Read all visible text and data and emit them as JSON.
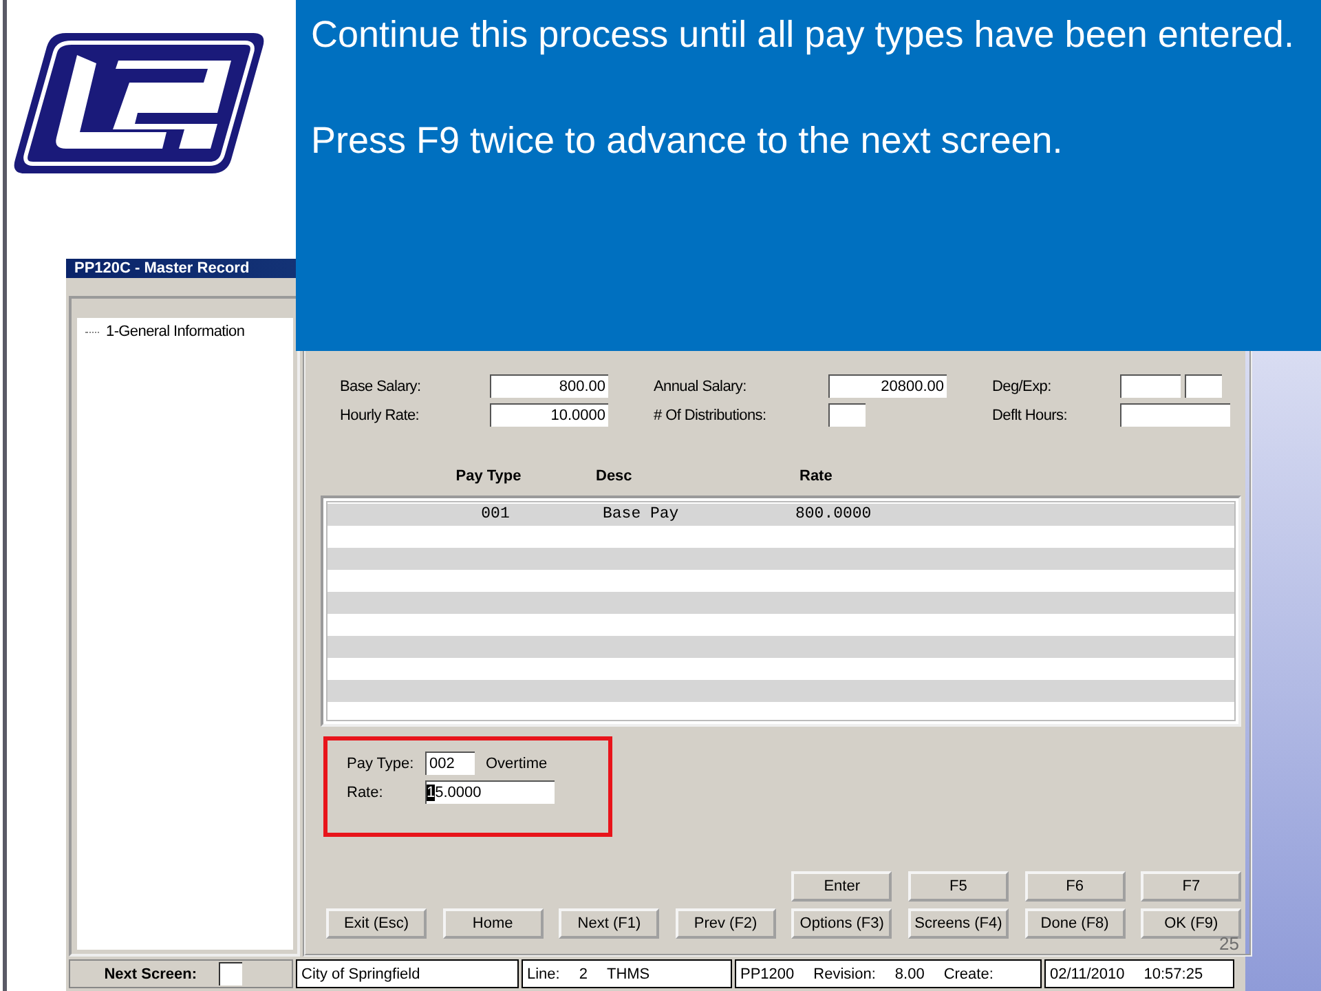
{
  "slide": {
    "callout": {
      "paragraphs": [
        "Continue this process until all pay types have been entered.",
        "Press F9 twice to advance to the next screen."
      ]
    },
    "page_number": "25"
  },
  "window": {
    "title": "PP120C - Master Record"
  },
  "tree": {
    "items": [
      {
        "label": "1-General Information"
      }
    ]
  },
  "fields": [
    {
      "label": "Base Salary:",
      "inputs": [
        {
          "kind": "wide",
          "value": "800.00"
        }
      ]
    },
    {
      "label": "Annual Salary:",
      "inputs": [
        {
          "kind": "wide",
          "value": "20800.00"
        }
      ]
    },
    {
      "label": "Deg/Exp:",
      "inputs": [
        {
          "kind": "medium"
        },
        {
          "kind": "short"
        }
      ]
    },
    {
      "label": "Hourly Rate:",
      "inputs": [
        {
          "kind": "wide",
          "value": "10.0000"
        }
      ]
    },
    {
      "label": "# Of Distributions:",
      "inputs": [
        {
          "kind": "short"
        }
      ]
    },
    {
      "label": "Deflt Hours:",
      "inputs": [
        {
          "kind": "wide"
        }
      ]
    }
  ],
  "table": {
    "columns": [
      "Pay Type",
      "Desc",
      "Rate"
    ],
    "rows": [
      [
        "001",
        "Base Pay",
        "800.0000"
      ]
    ]
  },
  "entry": {
    "pay_type": {
      "label": "Pay Type:",
      "value": "002",
      "description": "Overtime"
    },
    "rate": {
      "label": "Rate:",
      "value": "15.0000"
    }
  },
  "function_keys": [
    [
      "Enter",
      "F5",
      "F6",
      "F7"
    ],
    [
      "Exit (Esc)",
      "Home",
      "Next (F1)",
      "Prev (F2)",
      "Options (F3)",
      "Screens (F4)",
      "Done (F8)",
      "OK (F9)"
    ]
  ],
  "status_bar": {
    "next_screen_label": "Next Screen:",
    "sections": [
      [
        "City of Springfield"
      ],
      [
        "Line:",
        "2",
        "THMS"
      ],
      [
        "PP1200",
        "Revision:",
        "8.00",
        "Create:"
      ],
      [
        "02/11/2010",
        "10:57:25"
      ]
    ]
  }
}
